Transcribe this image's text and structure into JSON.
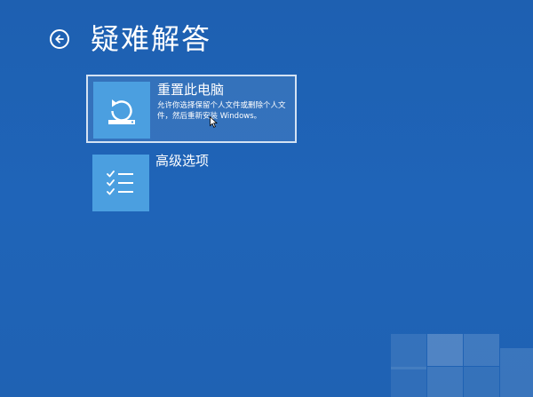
{
  "header": {
    "title": "疑难解答",
    "back_icon": "arrow-left-circle-icon"
  },
  "options": [
    {
      "title": "重置此电脑",
      "description": "允许你选择保留个人文件或删除个人文件，然后重新安装 Windows。",
      "icon": "reset-pc-icon",
      "selected": true
    },
    {
      "title": "高级选项",
      "description": "",
      "icon": "checklist-icon",
      "selected": false
    }
  ],
  "colors": {
    "background": "#1f63b5",
    "tile": "#4b9fe0",
    "text": "#ffffff"
  }
}
